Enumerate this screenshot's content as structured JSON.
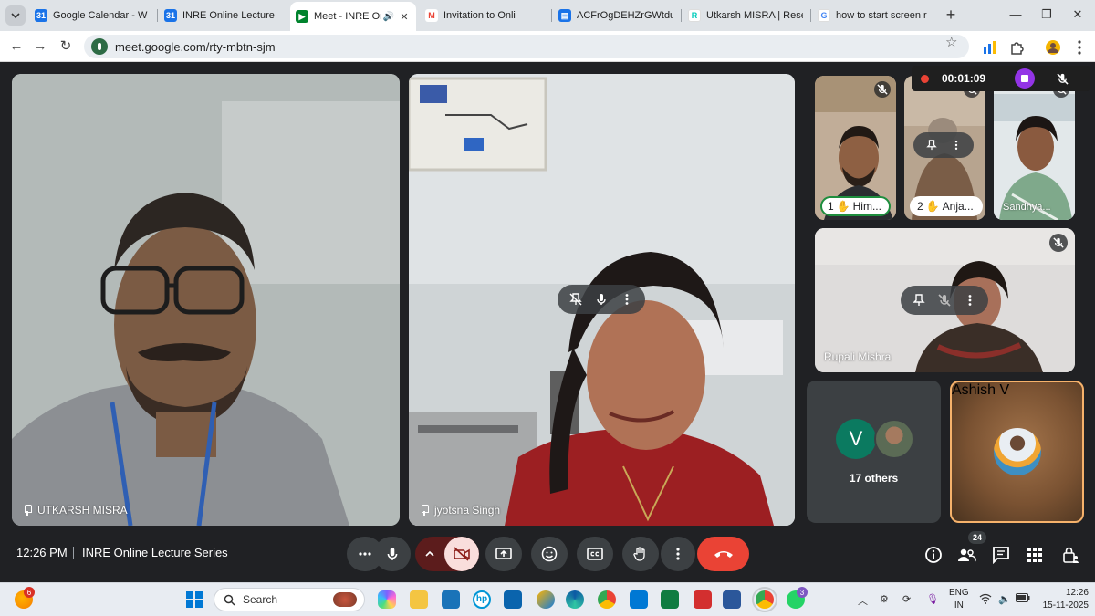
{
  "browser": {
    "tabs": [
      {
        "label": "Google Calendar - W",
        "color": "#1a73e8",
        "glyph": "31"
      },
      {
        "label": "INRE Online Lecture",
        "color": "#1a73e8",
        "glyph": "31"
      },
      {
        "label": "Meet - INRE Onli",
        "color": "#00832d",
        "glyph": "▶",
        "active": true
      },
      {
        "label": "Invitation to Onli",
        "color": "#ea4335",
        "glyph": "M"
      },
      {
        "label": "ACFrOgDEHZrGWtdu",
        "color": "#1a73e8",
        "glyph": "▤"
      },
      {
        "label": "Utkarsh MISRA | Rese",
        "color": "#ffffff",
        "glyph": "R"
      },
      {
        "label": "how to start screen r",
        "color": "#4285f4",
        "glyph": "G"
      }
    ],
    "url": "meet.google.com/rty-mbtn-sjm"
  },
  "meet": {
    "recording": {
      "time": "00:01:09"
    },
    "tiles": {
      "utkarsh": "UTKARSH MISRA",
      "jyotsna": "jyotsna Singh",
      "himanshu": "Him...",
      "himanshu_order": "1",
      "anjali": "Anja...",
      "anjali_order": "2",
      "sandhya": "Sandhya...",
      "rupali": "Rupali Mishra",
      "others_initial": "V",
      "others": "17 others",
      "ashish": "Ashish V"
    },
    "bar": {
      "time": "12:26 PM",
      "title": "INRE Online Lecture Series",
      "people_count": "24"
    }
  },
  "taskbar": {
    "weather_badge": "6",
    "search_placeholder": "Search",
    "whatsapp_badge": "3",
    "lang_line1": "ENG",
    "lang_line2": "IN",
    "time": "12:26",
    "date": "15-11-2025"
  },
  "colors": {
    "end_call": "#ea4335",
    "record_stop": "#9334e6",
    "speaking_border": "#f6b26b",
    "meet_bg": "#202124"
  }
}
